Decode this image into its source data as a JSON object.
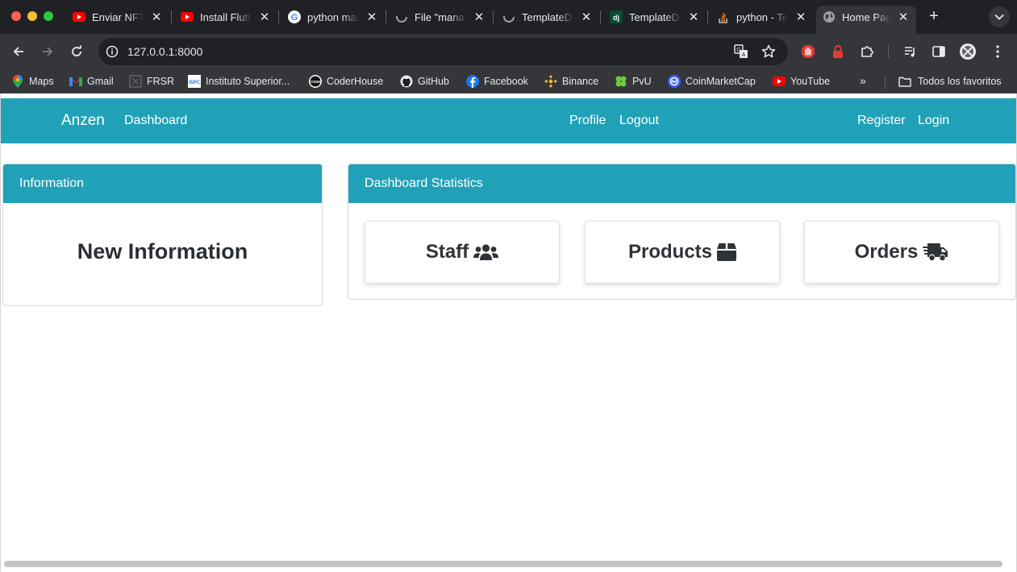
{
  "browser": {
    "tabs": [
      {
        "title": "Enviar NFT",
        "icon": "youtube-icon"
      },
      {
        "title": "Install Flutter",
        "icon": "youtube-icon"
      },
      {
        "title": "python manage",
        "icon": "google-icon"
      },
      {
        "title": "File \"manage",
        "icon": "loading-icon"
      },
      {
        "title": "TemplateDoes",
        "icon": "loading-icon"
      },
      {
        "title": "TemplateDoes",
        "icon": "django-icon"
      },
      {
        "title": "python - Te",
        "icon": "stackoverflow-icon"
      },
      {
        "title": "Home Page",
        "icon": "globe-icon",
        "active": true
      }
    ],
    "url": "127.0.0.1:8000",
    "bookmarks": [
      {
        "label": "Maps",
        "icon": "maps-icon"
      },
      {
        "label": "Gmail",
        "icon": "gmail-icon"
      },
      {
        "label": "FRSR",
        "icon": "frsr-icon"
      },
      {
        "label": "Instituto Superior...",
        "icon": "ispc-icon"
      },
      {
        "label": "CoderHouse",
        "icon": "coderhouse-icon"
      },
      {
        "label": "GitHub",
        "icon": "github-icon"
      },
      {
        "label": "Facebook",
        "icon": "facebook-icon"
      },
      {
        "label": "Binance",
        "icon": "binance-icon"
      },
      {
        "label": "PvU",
        "icon": "clover-icon"
      },
      {
        "label": "CoinMarketCap",
        "icon": "coinmarketcap-icon"
      },
      {
        "label": "YouTube",
        "icon": "youtube-icon"
      }
    ],
    "bookmarks_more": "»",
    "all_bookmarks": "Todos los favoritos"
  },
  "site": {
    "brand": "Anzen",
    "nav_left": [
      "Dashboard"
    ],
    "nav_center": [
      "Profile",
      "Logout"
    ],
    "nav_right": [
      "Register",
      "Login"
    ],
    "accent_color": "#21a1b8"
  },
  "info_card": {
    "header": "Information",
    "body_title": "New Information"
  },
  "stats_card": {
    "header": "Dashboard Statistics",
    "items": [
      {
        "label": "Staff",
        "icon": "users-icon"
      },
      {
        "label": "Products",
        "icon": "box-icon"
      },
      {
        "label": "Orders",
        "icon": "shipping-truck-icon"
      }
    ]
  }
}
